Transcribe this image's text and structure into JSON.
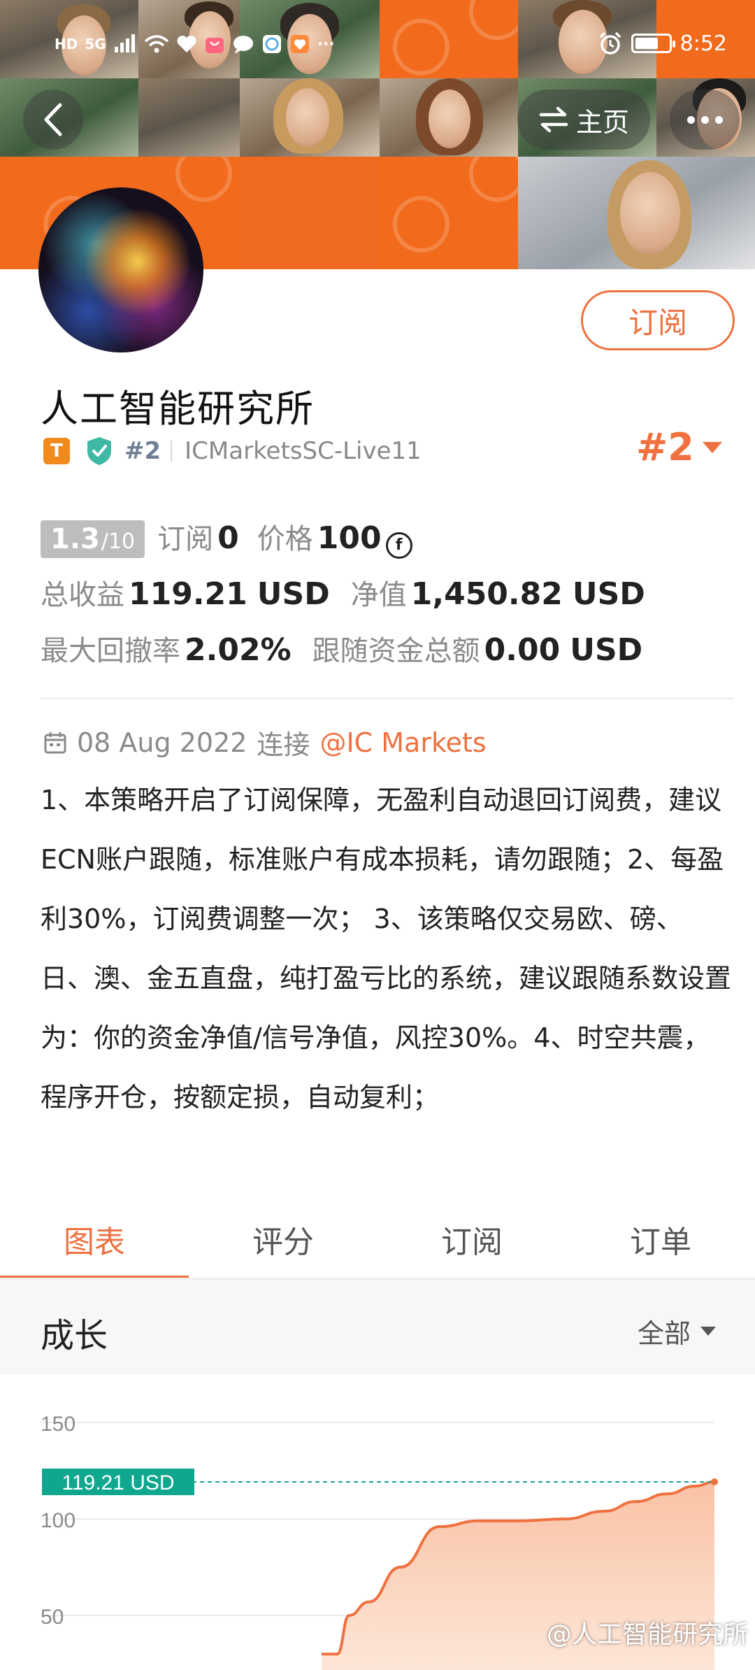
{
  "status_bar": {
    "left_chips": [
      "HD",
      "5G"
    ],
    "time": "8:52",
    "battery_level": 0.7
  },
  "header": {
    "home_label": "主页",
    "back_icon": "chevron-left-icon",
    "more_icon": "more-dots-icon",
    "switch_icon": "swap-arrows-icon"
  },
  "profile": {
    "subscribe_label": "订阅",
    "title": "人工智能研究所",
    "tier_badge": "T",
    "rank_small": "#2",
    "server": "ICMarketsSC-Live11",
    "rank_big": "#2"
  },
  "stats": {
    "score": "1.3",
    "score_den": "/10",
    "subscribers_label": "订阅",
    "subscribers_value": "0",
    "price_label": "价格",
    "price_value": "100",
    "price_currency_symbol": "f",
    "total_profit_label": "总收益",
    "total_profit_value": "119.21",
    "total_profit_currency": "USD",
    "equity_label": "净值",
    "equity_value": "1,450.82",
    "equity_currency": "USD",
    "max_drawdown_label": "最大回撤率",
    "max_drawdown_value": "2.02%",
    "follow_funds_label": "跟随资金总额",
    "follow_funds_value": "0.00",
    "follow_funds_currency": "USD"
  },
  "connection": {
    "date": "08 Aug 2022",
    "connect_word": "连接",
    "broker": "@IC Markets"
  },
  "description": "1、本策略开启了订阅保障，无盈利自动退回订阅费，建议ECN账户跟随，标准账户有成本损耗，请勿跟随；2、每盈利30%，订阅费调整一次； 3、该策略仅交易欧、磅、日、澳、金五直盘，纯打盈亏比的系统，建议跟随系数设置为：你的资金净值/信号净值，风控30%。4、时空共震，程序开仓，按额定损，自动复利；",
  "tabs": [
    {
      "label": "图表",
      "active": true
    },
    {
      "label": "评分",
      "active": false
    },
    {
      "label": "订阅",
      "active": false
    },
    {
      "label": "订单",
      "active": false
    }
  ],
  "growth": {
    "title": "成长",
    "filter_label": "全部"
  },
  "chart_data": {
    "type": "area",
    "y_ticks": [
      150,
      100,
      50
    ],
    "ylim": [
      30,
      155
    ],
    "current_label": "119.21 USD",
    "current_value": 119.21,
    "x": [
      0,
      4,
      7,
      12,
      20,
      30,
      40,
      50,
      62,
      72,
      80,
      88,
      95,
      100
    ],
    "y": [
      30,
      30,
      50,
      57,
      75,
      96,
      99,
      99,
      100,
      104,
      109,
      113,
      117,
      119.21
    ],
    "colors": {
      "line": "#ef7140",
      "fill": "#f9c2a4",
      "ref_line": "#1aa394",
      "label_bg": "#0fa88f"
    }
  },
  "watermark": "@人工智能研究所"
}
